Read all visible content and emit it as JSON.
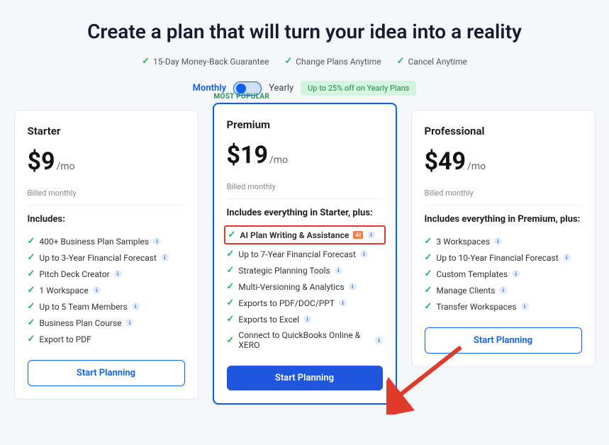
{
  "title": "Create a plan that will turn your idea into a reality",
  "guarantees": [
    "15-Day Money-Back Guarantee",
    "Change Plans Anytime",
    "Cancel Anytime"
  ],
  "toggle": {
    "monthly": "Monthly",
    "yearly": "Yearly",
    "badge": "Up to 25% off on Yearly Plans"
  },
  "popular": "MOST POPULAR",
  "billed": "Billed monthly",
  "per": "/mo",
  "btn": "Start Planning",
  "plans": {
    "starter": {
      "name": "Starter",
      "price": "$9",
      "includes": "Includes:",
      "features": [
        "400+ Business Plan Samples",
        "Up to 3-Year Financial Forecast",
        "Pitch Deck Creator",
        "1 Workspace",
        "Up to 5 Team Members",
        "Business Plan Course",
        "Export to PDF"
      ]
    },
    "premium": {
      "name": "Premium",
      "price": "$19",
      "includes": "Includes everything in Starter, plus:",
      "features": [
        "AI Plan Writing & Assistance",
        "Up to 7-Year Financial Forecast",
        "Strategic Planning Tools",
        "Multi-Versioning & Analytics",
        "Exports to PDF/DOC/PPT",
        "Exports to Excel",
        "Connect to QuickBooks Online & XERO"
      ]
    },
    "professional": {
      "name": "Professional",
      "price": "$49",
      "includes": "Includes everything in Premium, plus:",
      "features": [
        "3 Workspaces",
        "Up to 10-Year Financial Forecast",
        "Custom Templates",
        "Manage Clients",
        "Transfer Workspaces"
      ]
    }
  }
}
